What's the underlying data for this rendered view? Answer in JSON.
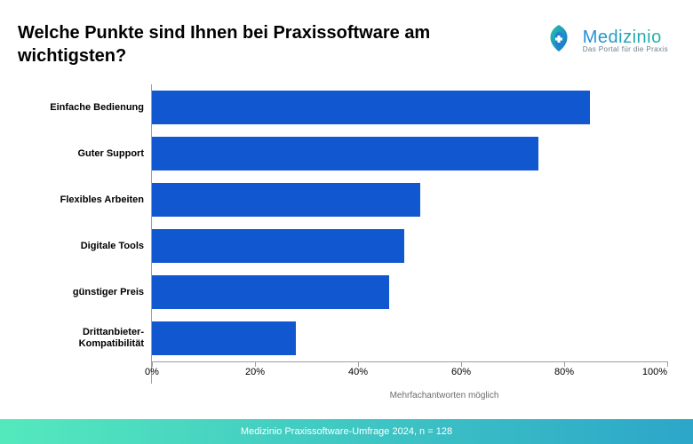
{
  "brand": {
    "wordmark": "Medizinio",
    "tagline": "Das Portal für die Praxis",
    "icon_name": "medizinio-logo-icon"
  },
  "chart_data": {
    "type": "bar",
    "orientation": "horizontal",
    "title": "Welche Punkte sind Ihnen bei Praxissoftware am wichtigsten?",
    "categories": [
      "Einfache Bedienung",
      "Guter Support",
      "Flexibles Arbeiten",
      "Digitale Tools",
      "günstiger Preis",
      "Drittanbieter-Kompatibilität"
    ],
    "values": [
      85,
      75,
      52,
      49,
      46,
      28
    ],
    "xlabel": "Mehrfachantworten möglich",
    "ylabel": "",
    "xlim": [
      0,
      100
    ],
    "x_ticks": [
      0,
      20,
      40,
      60,
      80,
      100
    ],
    "x_tick_labels": [
      "0%",
      "20%",
      "40%",
      "60%",
      "80%",
      "100%"
    ],
    "bar_color": "#1158d0"
  },
  "footer": {
    "source": "Medizinio Praxissoftware-Umfrage 2024, n = 128"
  }
}
